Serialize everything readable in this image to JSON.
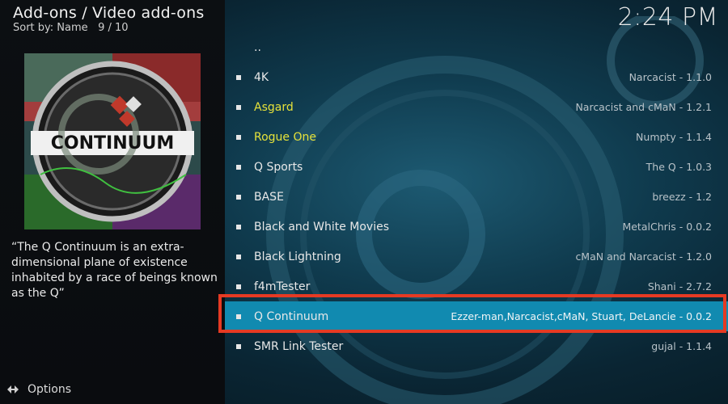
{
  "header": {
    "title": "Add-ons / Video add-ons",
    "sort_label": "Sort by: Name",
    "position": "9 / 10"
  },
  "clock": "2:24 PM",
  "selected_addon": {
    "logo_text": "CONTINUUM",
    "description": "“The Q Continuum is an extra-dimensional plane of existence inhabited by a race of beings known as the Q”"
  },
  "footer": {
    "options_label": "Options",
    "options_icon": "options-arrows-icon"
  },
  "list": {
    "parent_label": "..",
    "items": [
      {
        "name": "4K",
        "meta": "Narcacist - 1.1.0",
        "color": "default"
      },
      {
        "name": "Asgard",
        "meta": "Narcacist and cMaN - 1.2.1",
        "color": "yellow"
      },
      {
        "name": "Rogue One",
        "meta": "Numpty - 1.1.4",
        "color": "yellow"
      },
      {
        "name": "Q Sports",
        "meta": "The Q - 1.0.3",
        "color": "default"
      },
      {
        "name": "BASE",
        "meta": "breezz - 1.2",
        "color": "default"
      },
      {
        "name": "Black and White Movies",
        "meta": "MetalChris - 0.0.2",
        "color": "default"
      },
      {
        "name": "Black Lightning",
        "meta": "cMaN and Narcacist - 1.2.0",
        "color": "default"
      },
      {
        "name": "f4mTester",
        "meta": "Shani - 2.7.2",
        "color": "default"
      },
      {
        "name": "Q Continuum",
        "meta": "Ezzer-man,Narcacist,cMaN, Stuart, DeLancie - 0.0.2",
        "color": "default",
        "selected": true
      },
      {
        "name": "SMR Link Tester",
        "meta": "gujal - 1.1.4",
        "color": "default"
      }
    ]
  },
  "colors": {
    "selected_row": "#118ab0",
    "highlight_border": "#e53a23",
    "yellow_text": "#e6e23a"
  }
}
